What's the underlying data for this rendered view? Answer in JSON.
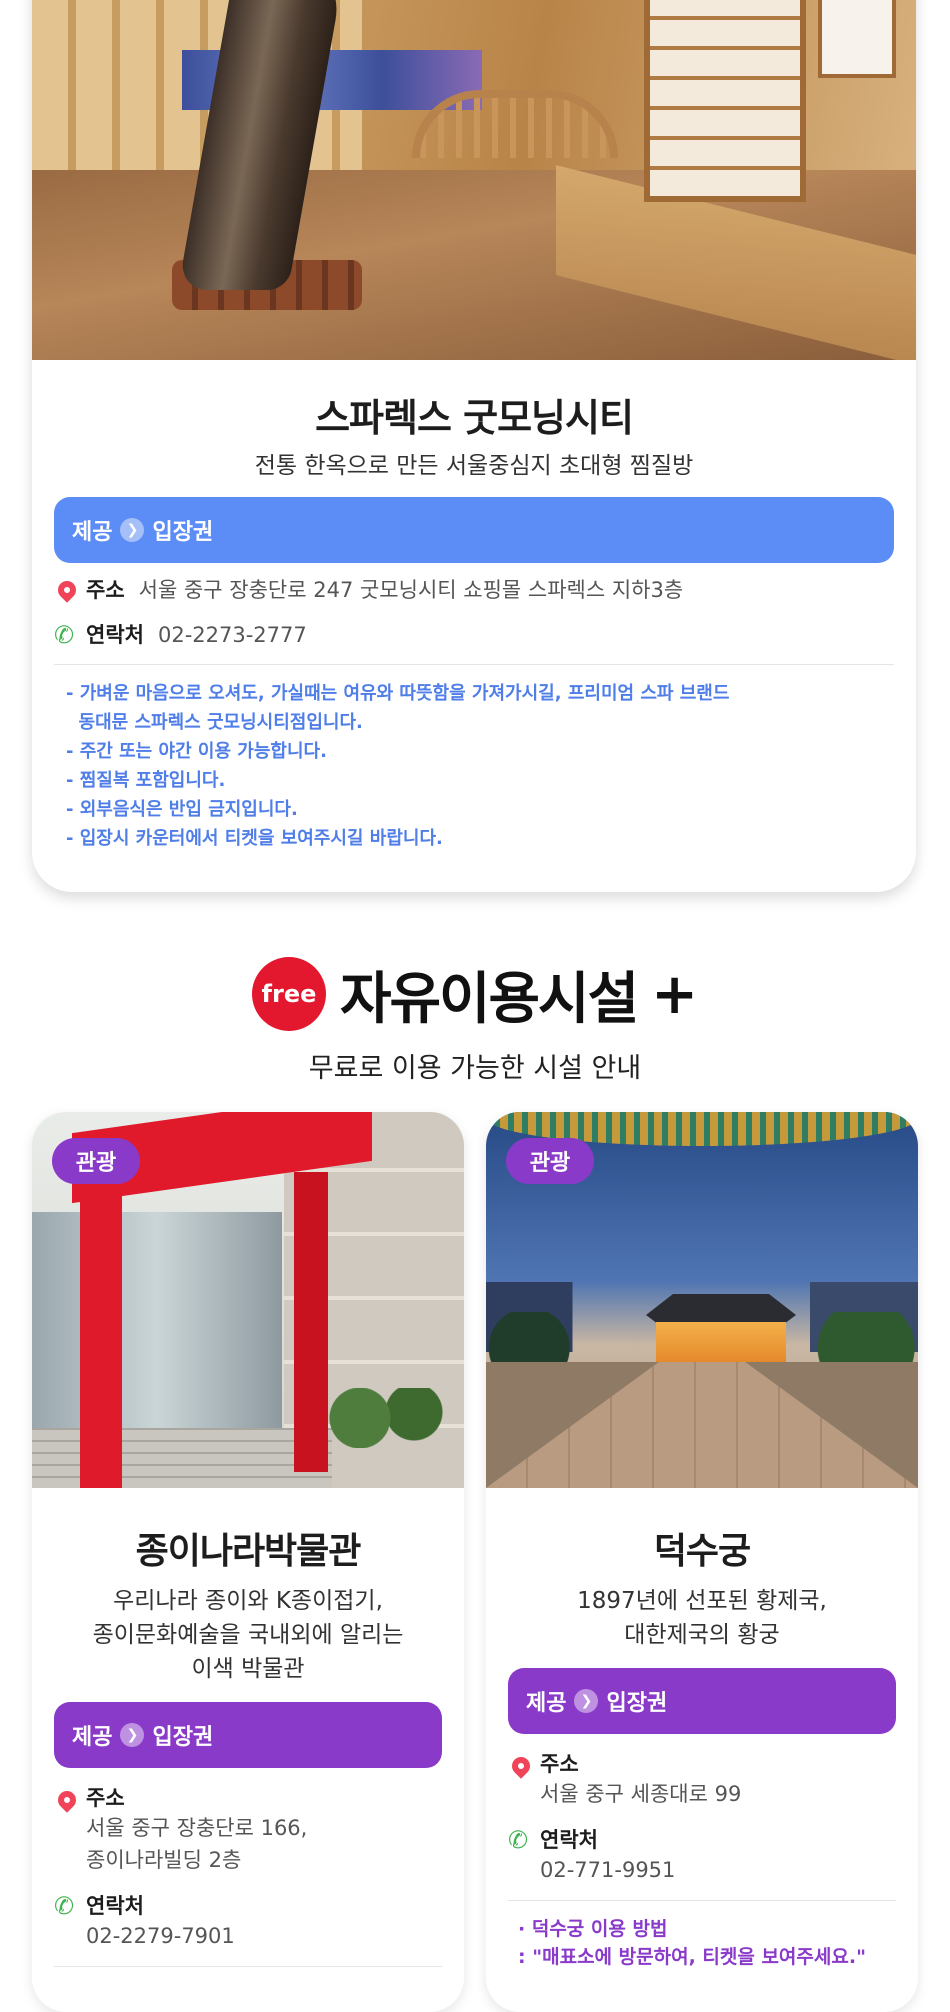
{
  "top_card": {
    "title": "스파렉스 굿모닝시티",
    "subtitle": "전통 한옥으로 만든 서울중심지 초대형 찜질방",
    "provide_label": "제공",
    "provide_value": "입장권",
    "address_label": "주소",
    "address_value": "서울 중구 장충단로 247 굿모닝시티 쇼핑몰 스파렉스 지하3층",
    "contact_label": "연락처",
    "contact_value": "02-2273-2777",
    "notes": [
      "- 가벼운 마음으로 오셔도, 가실때는 여유와 따뜻함을 가져가시길, 프리미엄 스파 브랜드",
      "  동대문 스파렉스 굿모닝시티점입니다.",
      "- 주간 또는 야간 이용 가능합니다.",
      "- 찜질복 포함입니다.",
      "- 외부음식은 반입 금지입니다.",
      "- 입장시 카운터에서 티켓을 보여주시길 바랍니다."
    ]
  },
  "section": {
    "badge": "free",
    "title": "자유이용시설",
    "plus": "+",
    "subtitle": "무료로 이용 가능한 시설 안내"
  },
  "facilities": [
    {
      "tag": "관광",
      "title": "종이나라박물관",
      "subtitle_lines": [
        "우리나라 종이와 K종이접기,",
        "종이문화예술을 국내외에 알리는",
        "이색 박물관"
      ],
      "provide_label": "제공",
      "provide_value": "입장권",
      "address_label": "주소",
      "address_lines": [
        "서울 중구 장충단로 166,",
        "종이나라빌딩 2층"
      ],
      "contact_label": "연락처",
      "contact_value": "02-2279-7901"
    },
    {
      "tag": "관광",
      "title": "덕수궁",
      "subtitle_lines": [
        "1897년에 선포된 황제국,",
        "대한제국의 황궁"
      ],
      "provide_label": "제공",
      "provide_value": "입장권",
      "address_label": "주소",
      "address_lines": [
        "서울 중구 세종대로 99"
      ],
      "contact_label": "연락처",
      "contact_value": "02-771-9951",
      "notes": [
        "· 덕수궁 이용 방법",
        ": \"매표소에 방문하여, 티켓을 보여주세요.\""
      ]
    }
  ],
  "colors": {
    "blue_bar": "#5c8cf5",
    "purple_bar": "#8a3ac9",
    "free_badge": "#e3172d",
    "notes_blue": "#4f7ee8"
  },
  "icons": {
    "address": "pin-icon",
    "contact": "phone-icon"
  }
}
